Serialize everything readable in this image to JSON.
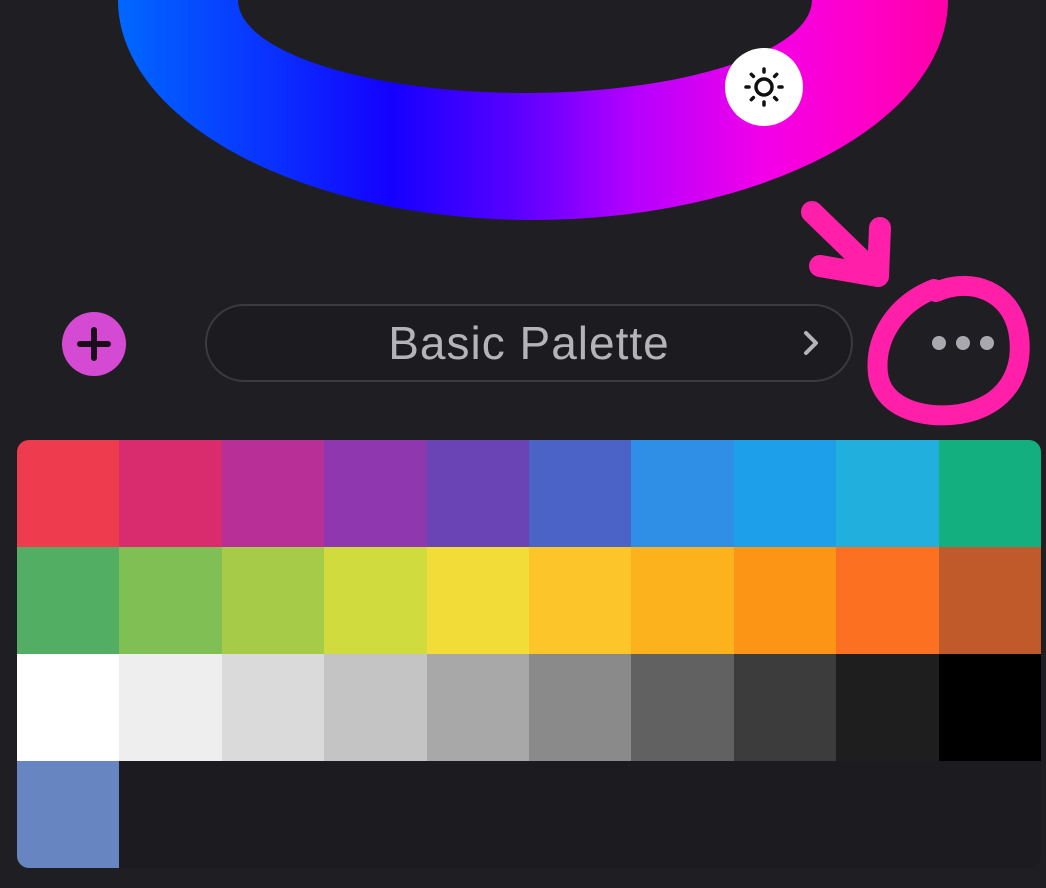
{
  "palette": {
    "name": "Basic Palette",
    "swatches": [
      "#EE3B4E",
      "#D92C6F",
      "#B72F97",
      "#8F37AE",
      "#6A44B5",
      "#4B62C6",
      "#2F8EE6",
      "#1E9FEA",
      "#21B0DE",
      "#13AF7F",
      "#52AE63",
      "#7FBF54",
      "#A5CB49",
      "#D0DB3D",
      "#F2DD38",
      "#FCC62B",
      "#FCB21C",
      "#FC9516",
      "#FC7121",
      "#C15A2A",
      "#FFFFFF",
      "#EEEEEE",
      "#DADADA",
      "#C4C4C4",
      "#A8A8A8",
      "#8A8A8A",
      "#616161",
      "#3C3C3C",
      "#1E1E1E",
      "#000000",
      "#6785C1"
    ]
  },
  "colors": {
    "background": "#1f1f23",
    "accent": "#D54AD2",
    "annotation": "#FF1FA8"
  },
  "icons": {
    "brightness": "sun-icon",
    "add": "plus-icon",
    "next": "chevron-right-icon",
    "more": "ellipsis-icon"
  }
}
